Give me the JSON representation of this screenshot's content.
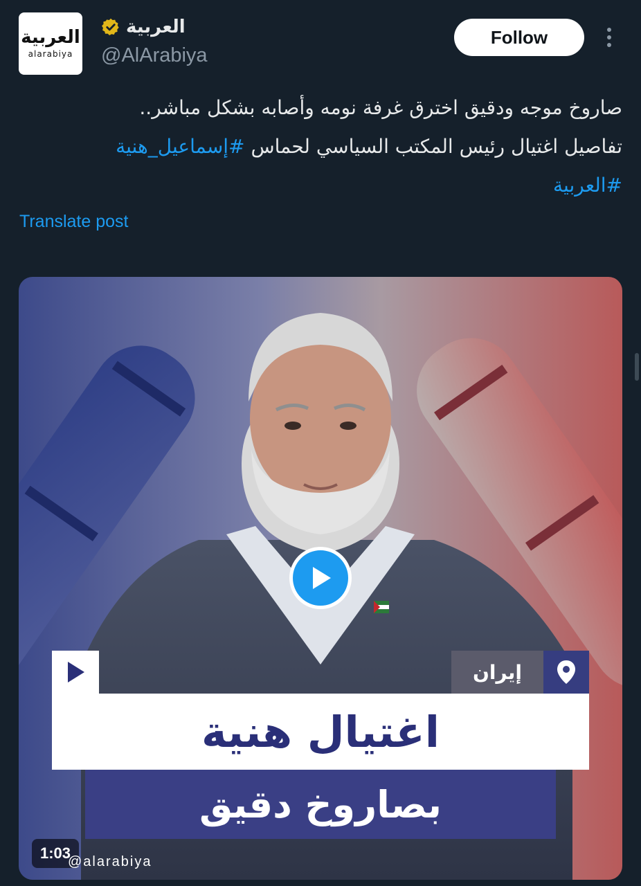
{
  "tweet": {
    "avatar": {
      "logo_ar": "العربية",
      "logo_en": "alarabiya"
    },
    "display_name": "العربية",
    "handle": "@AlArabiya",
    "follow_label": "Follow",
    "text_lines": [
      "صاروخ موجه ودقيق اخترق غرفة نومه وأصابه بشكل مباشر..",
      "تفاصيل اغتيال رئيس المكتب السياسي لحماس"
    ],
    "hashtag_inline": "#إسماعيل_هنية",
    "hashtag_2": "#العربية",
    "translate_label": "Translate post"
  },
  "media": {
    "location": "إيران",
    "headline_1": "اغتيال هنية",
    "headline_2": "بصاروخ دقيق",
    "duration": "1:03",
    "watermark": "@alarabiya"
  },
  "colors": {
    "background": "#15202b",
    "accent": "#1d9bf0",
    "verified_badge": "#e2b719",
    "headline_blue": "#2a2f78"
  },
  "icons": [
    "verified-badge-icon",
    "more-options-icon",
    "play-icon",
    "location-pin-icon"
  ]
}
